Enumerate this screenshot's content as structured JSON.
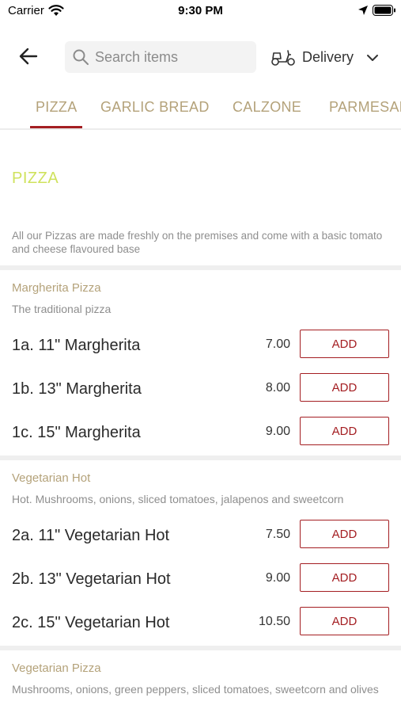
{
  "status_bar": {
    "carrier": "Carrier",
    "time": "9:30 PM"
  },
  "header": {
    "search_placeholder": "Search items",
    "delivery_label": "Delivery"
  },
  "tabs": [
    "PIZZA",
    "GARLIC BREAD",
    "CALZONE",
    "PARMESAN"
  ],
  "active_tab": 0,
  "section": {
    "title": "PIZZA",
    "description": "All our Pizzas are made freshly on the premises and come with a basic tomato and cheese flavoured base"
  },
  "groups": [
    {
      "title": "Margherita Pizza",
      "description": "The traditional pizza",
      "items": [
        {
          "name": "1a. 11\" Margherita",
          "price": "7.00",
          "button": "ADD"
        },
        {
          "name": "1b. 13\" Margherita",
          "price": "8.00",
          "button": "ADD"
        },
        {
          "name": "1c. 15\" Margherita",
          "price": "9.00",
          "button": "ADD"
        }
      ]
    },
    {
      "title": "Vegetarian Hot",
      "description": "Hot. Mushrooms, onions, sliced tomatoes, jalapenos and sweetcorn",
      "items": [
        {
          "name": "2a. 11\" Vegetarian Hot",
          "price": "7.50",
          "button": "ADD"
        },
        {
          "name": "2b. 13\" Vegetarian Hot",
          "price": "9.00",
          "button": "ADD"
        },
        {
          "name": "2c. 15\" Vegetarian Hot",
          "price": "10.50",
          "button": "ADD"
        }
      ]
    },
    {
      "title": "Vegetarian Pizza",
      "description": "Mushrooms, onions, green peppers, sliced tomatoes, sweetcorn and olives",
      "items": []
    }
  ],
  "colors": {
    "accent": "#a41e22",
    "gold": "#b4a27a",
    "section_title": "#cfe25d"
  }
}
